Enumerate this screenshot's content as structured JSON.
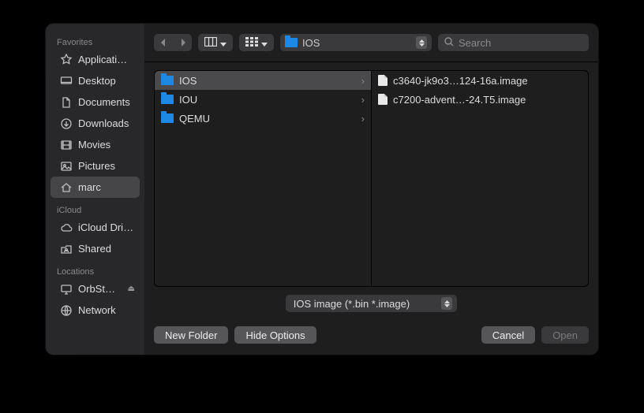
{
  "sidebar": {
    "sections": [
      {
        "label": "Favorites",
        "items": [
          {
            "icon": "applications",
            "label": "Applicati…",
            "selected": false
          },
          {
            "icon": "desktop",
            "label": "Desktop",
            "selected": false
          },
          {
            "icon": "documents",
            "label": "Documents",
            "selected": false
          },
          {
            "icon": "downloads",
            "label": "Downloads",
            "selected": false
          },
          {
            "icon": "movies",
            "label": "Movies",
            "selected": false
          },
          {
            "icon": "pictures",
            "label": "Pictures",
            "selected": false
          },
          {
            "icon": "home",
            "label": "marc",
            "selected": true
          }
        ]
      },
      {
        "label": "iCloud",
        "items": [
          {
            "icon": "cloud",
            "label": "iCloud Dri…",
            "selected": false
          },
          {
            "icon": "shared",
            "label": "Shared",
            "selected": false
          }
        ]
      },
      {
        "label": "Locations",
        "items": [
          {
            "icon": "display",
            "label": "OrbSt…",
            "selected": false,
            "eject": true
          },
          {
            "icon": "network",
            "label": "Network",
            "selected": false
          }
        ]
      }
    ]
  },
  "toolbar": {
    "path_label": "IOS",
    "search_placeholder": "Search"
  },
  "columns": [
    {
      "items": [
        {
          "type": "folder",
          "label": "IOS",
          "selected": true,
          "chevron": true
        },
        {
          "type": "folder",
          "label": "IOU",
          "selected": false,
          "chevron": true
        },
        {
          "type": "folder",
          "label": "QEMU",
          "selected": false,
          "chevron": true
        }
      ]
    },
    {
      "items": [
        {
          "type": "file",
          "label": "c3640-jk9o3…124-16a.image",
          "selected": false
        },
        {
          "type": "file",
          "label": "c7200-advent…-24.T5.image",
          "selected": false
        }
      ]
    }
  ],
  "filetype": {
    "label": "IOS image (*.bin *.image)"
  },
  "footer": {
    "new_folder": "New Folder",
    "hide_options": "Hide Options",
    "cancel": "Cancel",
    "open": "Open"
  }
}
